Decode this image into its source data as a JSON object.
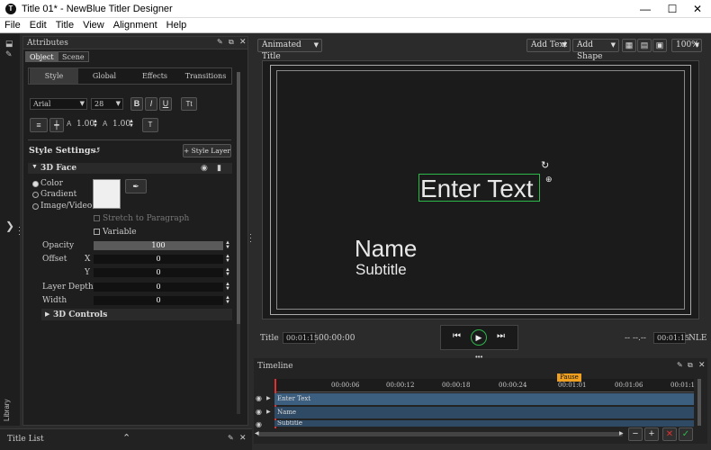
{
  "window": {
    "title": "Title 01* - NewBlue Titler Designer",
    "min": "—",
    "max": "☐",
    "close": "✕"
  },
  "menu": [
    "File",
    "Edit",
    "Title",
    "View",
    "Alignment",
    "Help"
  ],
  "attributes": {
    "header": "Attributes",
    "tabs": [
      "Object",
      "Scene"
    ],
    "subtabs": [
      "Style",
      "Global",
      "Effects",
      "Transitions"
    ],
    "font": "Arial",
    "size": "28",
    "bold": "B",
    "italic": "I",
    "underline": "U",
    "text_size_btn": "Tt",
    "line_spacing": "1.00",
    "char_spacing": "1.00",
    "tt_btn": "T",
    "style_settings": "Style Settings",
    "style_layer": "+ Style Layer",
    "face": "3D Face",
    "fill_options": [
      "Color",
      "Gradient",
      "Image/Video"
    ],
    "stretch": "Stretch to Paragraph",
    "variable": "Variable",
    "props": [
      {
        "label": "Opacity",
        "axis": "",
        "value": "100"
      },
      {
        "label": "Offset",
        "axis": "X",
        "value": "0"
      },
      {
        "label": "",
        "axis": "Y",
        "value": "0"
      },
      {
        "label": "Layer Depth",
        "axis": "",
        "value": "0"
      },
      {
        "label": "Width",
        "axis": "",
        "value": "0"
      }
    ],
    "controls": "3D Controls"
  },
  "library": "Library",
  "title_list": "Title List",
  "toolbar": {
    "preset": "Animated Title",
    "add_text": "Add Text",
    "add_shape": "Add Shape",
    "zoom": "100%"
  },
  "canvas": {
    "enter_text": "Enter Text",
    "name": "Name",
    "subtitle": "Subtitle"
  },
  "transport": {
    "title_label": "Title",
    "title_time": "00:01:15",
    "start_time": "00:00:00",
    "end_dash": "-- --.--",
    "end_time": "00:01:15",
    "nle": "NLE"
  },
  "timeline": {
    "header": "Timeline",
    "pause": "Pause",
    "ticks": [
      "00:00:06",
      "00:00:12",
      "00:00:18",
      "00:00:24",
      "00:01:01",
      "00:01:06",
      "00:01:1"
    ],
    "tracks": [
      "Enter Text",
      "Name",
      "Subtitle"
    ],
    "zoom_out": "−",
    "zoom_in": "+"
  },
  "colors": {
    "accent": "#1e6fd9",
    "selection": "#2db84a",
    "track": "#3d5f7f",
    "pause": "#f0a020"
  }
}
